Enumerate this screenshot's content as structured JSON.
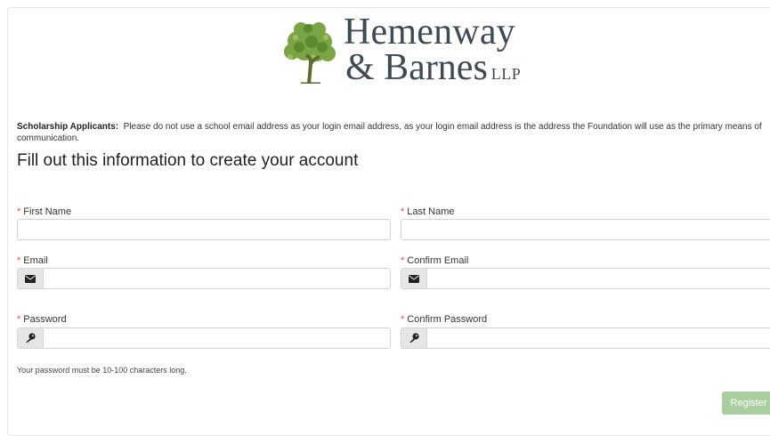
{
  "logo": {
    "line1": "Hemenway",
    "line2": "& Barnes",
    "suffix": "LLP"
  },
  "notice": {
    "bold": "Scholarship Applicants:",
    "text": "Please do not use a school email address as your login email address, as your login email address is the address the Foundation will use as the primary means of communication."
  },
  "form": {
    "title": "Fill out this information to create your account",
    "required_mark": "*",
    "first_name_label": "First Name",
    "last_name_label": "Last Name",
    "email_label": "Email",
    "confirm_email_label": "Confirm Email",
    "password_label": "Password",
    "confirm_password_label": "Confirm Password",
    "password_hint": "Your password must be 10-100 characters long.",
    "register_label": "Register",
    "first_name_value": "",
    "last_name_value": "",
    "email_value": "",
    "confirm_email_value": "",
    "password_value": "",
    "confirm_password_value": ""
  },
  "icons": {
    "email": "envelope-icon",
    "password": "key-icon"
  },
  "colors": {
    "required": "#d9534f",
    "register_button": "#a9cfa0",
    "logo_text": "#3f4a55",
    "tree_green": "#6e9a3a"
  }
}
